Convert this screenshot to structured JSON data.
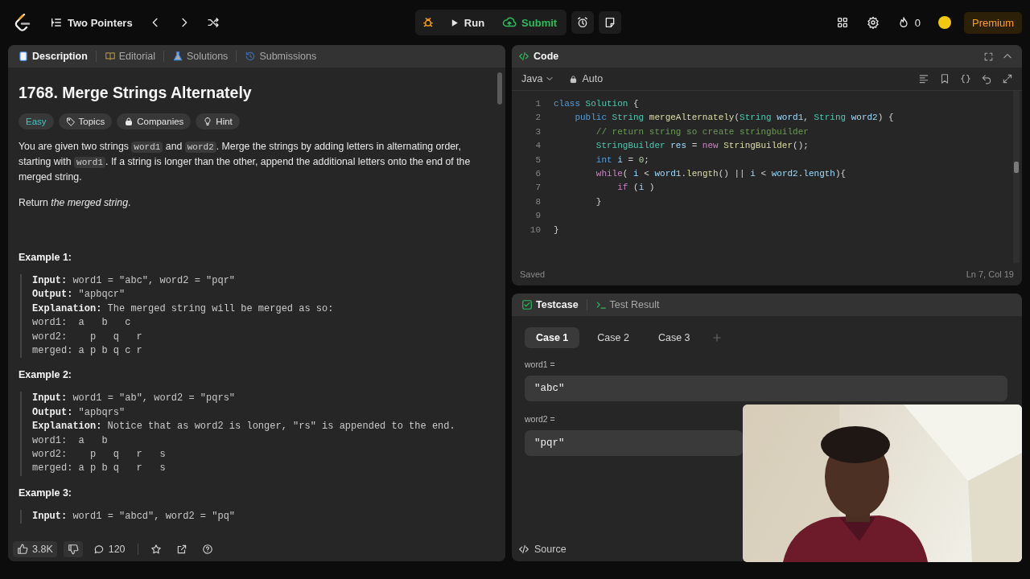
{
  "topbar": {
    "problem_list": "Two Pointers",
    "run": "Run",
    "submit": "Submit",
    "streak": "0",
    "premium": "Premium"
  },
  "description_panel": {
    "tabs": [
      {
        "label": "Description",
        "selected": true
      },
      {
        "label": "Editorial",
        "selected": false
      },
      {
        "label": "Solutions",
        "selected": false
      },
      {
        "label": "Submissions",
        "selected": false
      }
    ],
    "title": "1768. Merge Strings Alternately",
    "tags": [
      {
        "label": "Easy",
        "kind": "difficulty"
      },
      {
        "label": "Topics",
        "kind": "topics"
      },
      {
        "label": "Companies",
        "kind": "companies"
      },
      {
        "label": "Hint",
        "kind": "hint"
      }
    ],
    "statement": [
      {
        "text": "You are given two strings ",
        "kind": "text"
      },
      {
        "text": "word1",
        "kind": "code"
      },
      {
        "text": " and ",
        "kind": "text"
      },
      {
        "text": "word2",
        "kind": "code"
      },
      {
        "text": ". Merge the strings by adding letters in alternating order, starting with ",
        "kind": "text"
      },
      {
        "text": "word1",
        "kind": "code"
      },
      {
        "text": ". If a string is longer than the other, append the additional letters onto the end of the merged string.",
        "kind": "text"
      }
    ],
    "return_note": "Return *the merged string*.",
    "examples": [
      {
        "heading": "Example 1:",
        "lines": [
          "**Input:** word1 = \"abc\", word2 = \"pqr\"",
          "**Output:** \"apbqcr\"",
          "**Explanation:** The merged string will be merged as so:",
          "word1:  a   b   c",
          "word2:    p   q   r",
          "merged: a p b q c r"
        ]
      },
      {
        "heading": "Example 2:",
        "lines": [
          "**Input:** word1 = \"ab\", word2 = \"pqrs\"",
          "**Output:** \"apbqrs\"",
          "**Explanation:** Notice that as word2 is longer, \"rs\" is appended to the end.",
          "word1:  a   b",
          "word2:    p   q   r   s",
          "merged: a p b q   r   s"
        ]
      },
      {
        "heading": "Example 3:",
        "lines": [
          "**Input:** word1 = \"abcd\", word2 = \"pq\""
        ]
      }
    ],
    "footer": {
      "likes": "3.8K",
      "comments": "120"
    }
  },
  "code_panel": {
    "title": "Code",
    "language": "Java",
    "mode": "Auto",
    "status": "Saved",
    "cursor": "Ln 7, Col 19",
    "lines": [
      {
        "number": "1",
        "tokens": [
          {
            "text": "class",
            "kind": "keyword"
          },
          {
            "text": " Solution",
            "kind": "type"
          },
          {
            "text": " {",
            "kind": "plain"
          }
        ]
      },
      {
        "number": "2",
        "tokens": [
          {
            "text": "    public",
            "kind": "keyword"
          },
          {
            "text": " String",
            "kind": "type"
          },
          {
            "text": " mergeAlternately",
            "kind": "func"
          },
          {
            "text": "(",
            "kind": "plain"
          },
          {
            "text": "String",
            "kind": "type"
          },
          {
            "text": " word1",
            "kind": "var"
          },
          {
            "text": ", ",
            "kind": "plain"
          },
          {
            "text": "String",
            "kind": "type"
          },
          {
            "text": " word2",
            "kind": "var"
          },
          {
            "text": ") {",
            "kind": "plain"
          }
        ]
      },
      {
        "number": "3",
        "tokens": [
          {
            "text": "        // return string so create stringbuilder",
            "kind": "comment"
          }
        ]
      },
      {
        "number": "4",
        "tokens": [
          {
            "text": "        StringBuilder",
            "kind": "type"
          },
          {
            "text": " res",
            "kind": "var"
          },
          {
            "text": " = ",
            "kind": "plain"
          },
          {
            "text": "new",
            "kind": "control"
          },
          {
            "text": " StringBuilder",
            "kind": "func"
          },
          {
            "text": "();",
            "kind": "plain"
          }
        ]
      },
      {
        "number": "5",
        "tokens": [
          {
            "text": "        int",
            "kind": "keyword"
          },
          {
            "text": " i",
            "kind": "var"
          },
          {
            "text": " = ",
            "kind": "plain"
          },
          {
            "text": "0",
            "kind": "number"
          },
          {
            "text": ";",
            "kind": "plain"
          }
        ]
      },
      {
        "number": "6",
        "tokens": [
          {
            "text": "        while",
            "kind": "control"
          },
          {
            "text": "( ",
            "kind": "plain"
          },
          {
            "text": "i",
            "kind": "var"
          },
          {
            "text": " < ",
            "kind": "plain"
          },
          {
            "text": "word1",
            "kind": "var"
          },
          {
            "text": ".",
            "kind": "plain"
          },
          {
            "text": "length",
            "kind": "func"
          },
          {
            "text": "() || ",
            "kind": "plain"
          },
          {
            "text": "i",
            "kind": "var"
          },
          {
            "text": " < ",
            "kind": "plain"
          },
          {
            "text": "word2",
            "kind": "var"
          },
          {
            "text": ".",
            "kind": "plain"
          },
          {
            "text": "length",
            "kind": "var"
          },
          {
            "text": "){",
            "kind": "plain"
          }
        ]
      },
      {
        "number": "7",
        "tokens": [
          {
            "text": "            if",
            "kind": "control"
          },
          {
            "text": " (",
            "kind": "plain"
          },
          {
            "text": "i",
            "kind": "var"
          },
          {
            "text": " )",
            "kind": "plain"
          }
        ]
      },
      {
        "number": "8",
        "tokens": [
          {
            "text": "        }",
            "kind": "plain"
          }
        ]
      },
      {
        "number": "9"
      },
      {
        "number": "10",
        "tokens": [
          {
            "text": "}",
            "kind": "plain"
          }
        ]
      }
    ]
  },
  "testcase_panel": {
    "tabs": [
      {
        "label": "Testcase",
        "selected": true
      },
      {
        "label": "Test Result",
        "selected": false
      }
    ],
    "cases": [
      {
        "label": "Case 1",
        "selected": true
      },
      {
        "label": "Case 2",
        "selected": false
      },
      {
        "label": "Case 3",
        "selected": false
      }
    ],
    "params": [
      {
        "name": "word1 =",
        "value": "\"abc\""
      },
      {
        "name": "word2 =",
        "value": "\"pqr\""
      }
    ],
    "source": "Source"
  }
}
